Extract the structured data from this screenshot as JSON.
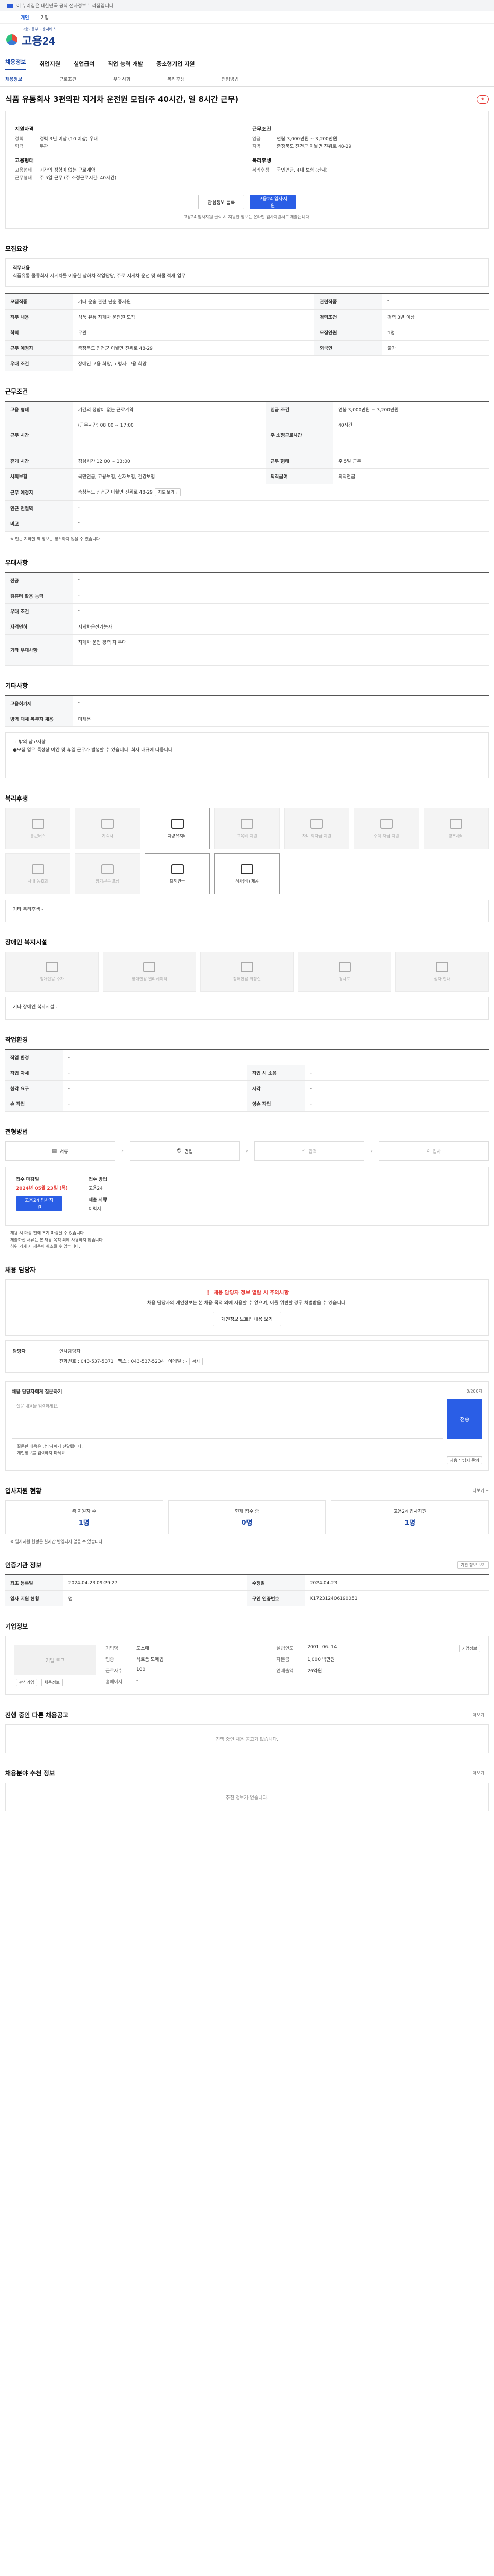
{
  "topbar": {
    "notice": "이 누리집은 대한민국 공식 전자정부 누리집입니다.",
    "toggle": "▼"
  },
  "mode": {
    "a": "개인",
    "b": "기업"
  },
  "logo": {
    "name": "고용24",
    "sub1": "고용노동부 고용서비스",
    "sub2": "통합 플랫폼"
  },
  "gnb": [
    "채용정보",
    "취업지원",
    "실업급여",
    "직업 능력 개발",
    "중소형기업 지원"
  ],
  "subnav": [
    "채용정보",
    "근로조건",
    "우대사항",
    "복리후생",
    "전형방법"
  ],
  "job": {
    "title": "식품 유통회사 3편의판 지게차 운전원 모집(주 40시간, 일 8시간 근무)",
    "scrap": "스크랩"
  },
  "summary": {
    "left": {
      "h1": "지원자격",
      "k1": "경력",
      "v1": "경력 3년 이상 (10 이상) 우대",
      "k2": "학력",
      "v2": "무관",
      "h2": "고용형태",
      "k3": "고용형태",
      "v3": "기간의 정함이 없는 근로계약",
      "k4": "근무형태",
      "v4": "주 5일 근무 (주 소정근로시간: 40시간)"
    },
    "right": {
      "h1": "근무조건",
      "k1": "임금",
      "v1": "연봉 3,000만원 ~ 3,200만원",
      "k2": "지역",
      "v2": "충청북도 진천군 이월면 진위로 48-29",
      "h2": "복리후생",
      "k3": "복리후생",
      "v3": "국민연금, 4대 보험 (산재)"
    }
  },
  "actions": {
    "interest": "관심정보 등록",
    "apply": "고용24 입사지원"
  },
  "actions_note": "고용24 입사지원 클릭 시 지원한 정보는 온라인 입사지원서로 제출됩니다.",
  "s1": {
    "title": "모집요강",
    "box_h": "직무내용",
    "box": "식품유통 물류회사 지게차를 이용한 상하차 작업담당, 주로 지게차 운전 및 화물 적재 업무",
    "rows": [
      [
        "모집직종",
        "기타 운송 관련 단순 종사원",
        "관련직종",
        "-"
      ],
      [
        "직무 내용",
        "식품 유통 지게차 운전원 모집",
        "경력조건",
        "경력 3년 이상"
      ],
      [
        "학력",
        "무관",
        "모집인원",
        "1명"
      ],
      [
        "근무 예정지",
        "충청북도 진천군 이월면 진위로 48-29",
        "외국인",
        "불가"
      ],
      [
        "우대 조건",
        "장애인 고용 희망, 고령자 고용 희망",
        "",
        ""
      ]
    ]
  },
  "s2": {
    "title": "근무조건",
    "rows": [
      [
        "고용 형태",
        "기간의 정함이 없는 근로계약",
        "임금 조건",
        "연봉 3,000만원 ~ 3,200만원"
      ],
      [
        "근무 시간",
        "(근무시간) 08:00 ~ 17:00",
        "주 소정근로시간",
        "40시간"
      ],
      [
        "휴게 시간",
        "점심시간 12:00 ~ 13:00",
        "근무 형태",
        "주 5일 근무"
      ],
      [
        "사회보험",
        "국민연금, 고용보험, 산재보험, 건강보험",
        "퇴직급여",
        "퇴직연금"
      ],
      [
        "근무 예정지",
        "충청북도 진천군 이월면 진위로 48-29",
        "",
        ""
      ],
      [
        "인근 전철역",
        "-",
        "",
        ""
      ],
      [
        "비고",
        "-",
        "",
        ""
      ]
    ],
    "note": "※ 인근 지하철 역 정보는 정확하지 않을 수 있습니다."
  },
  "s3": {
    "title": "우대사항",
    "rows": [
      [
        "전공",
        "-"
      ],
      [
        "컴퓨터 활용 능력",
        "-"
      ],
      [
        "우대 조건",
        "-"
      ],
      [
        "자격면허",
        "지게차운전기능사"
      ],
      [
        "기타 우대사항",
        "지게차 운전 경력 자 우대"
      ]
    ]
  },
  "s4": {
    "title": "기타사항",
    "rows": [
      [
        "고용허가제",
        "-"
      ],
      [
        "병역 대체 복무자 채용",
        "미채용"
      ]
    ],
    "etc": "그 밖의 참고사항\n●모집 업무 특성상 야간 및 휴일 근무가 발생할 수 있습니다. 회사 내규에 따릅니다."
  },
  "s5": {
    "title": "복리후생",
    "items": [
      "통근버스",
      "기숙사",
      "차량유지비",
      "교육비 지원",
      "자녀 학자금 지원",
      "주택 자금 지원",
      "경조사비",
      "사내 동호회",
      "장기근속 포상",
      "퇴직연금",
      "식사(비) 제공"
    ],
    "note": "기타 복리후생 -"
  },
  "s6": {
    "title": "장애인 복지시설",
    "items": [
      "장애인용 주차",
      "장애인용 엘리베이터",
      "장애인용 화장실",
      "경사로",
      "점자 안내"
    ],
    "note": "기타 장애인 복지시설 -"
  },
  "s7": {
    "title": "작업환경",
    "rows": [
      [
        "작업 환경",
        "-",
        "",
        ""
      ],
      [
        "작업 자세",
        "-",
        "작업 시 소음",
        "-"
      ],
      [
        "청각 요구",
        "-",
        "시각",
        "-"
      ],
      [
        "손 작업",
        "-",
        "양손 작업",
        "-"
      ]
    ]
  },
  "s8": {
    "title": "전형방법",
    "steps": [
      "서류",
      "면접",
      "합격",
      "입사"
    ],
    "apply": {
      "k1": "접수 마감일",
      "v1": "2024년 05월 23일 (목)",
      "k2": "접수 방법",
      "v2": "고용24",
      "k3": "제출 서류",
      "v3": "이력서",
      "btn": "고용24 입사지원"
    },
    "notes": [
      "채용 시 마감 전에 조기 마감될 수 있습니다.",
      "제출하신 서류는 본 채용 목적 외에 사용하지 않습니다.",
      "허위 기재 시 채용이 취소될 수 있습니다."
    ]
  },
  "s9": {
    "title": "채용 담당자",
    "warn_h": "❗ 채용 담당자 정보 열람 시 주의사항",
    "warn": "채용 담당자의 개인정보는 본 채용 목적 외에 사용할 수 없으며, 이를 위반할 경우 처벌받을 수 있습니다.",
    "btn": "개인정보 보호법 내용 보기",
    "contact": {
      "k": "담당자",
      "name": "인사담당자",
      "phone": "전화번호 : 043-537-5371",
      "fax": "팩스 : 043-537-5234",
      "email": "이메일 : -",
      "copy": "복사"
    }
  },
  "s10": {
    "title": "채용 담당자에게 질문하기",
    "count": "0/200자",
    "placeholder": "질문 내용을 입력하세요.",
    "send": "전송",
    "notes": [
      "질문한 내용은 담당자에게 전달됩니다.",
      "개인정보를 입력하지 마세요."
    ],
    "btn": "채용 담당자 문의"
  },
  "s11": {
    "title": "입사지원 현황",
    "more": "더보기 +",
    "stats": [
      [
        "총 지원자 수",
        "1명"
      ],
      [
        "현재 접수 중",
        "0명"
      ],
      [
        "고용24 입사지원",
        "1명"
      ]
    ],
    "note": "※ 입사지원 현황은 실시간 반영되지 않을 수 있습니다."
  },
  "s12": {
    "title": "인증기관 정보",
    "btn": "기관 정보 보기",
    "rows": [
      [
        "최초 등록일",
        "2024-04-23 09:29:27",
        "수정일",
        "2024-04-23"
      ],
      [
        "입사 지원 현황",
        "명",
        "구인 인증번호",
        "K172312406190051"
      ]
    ]
  },
  "s13": {
    "title": "기업정보",
    "logo": "기업 로고",
    "rows": [
      [
        "기업명",
        "도소매",
        "설립연도",
        "2001. 06. 14"
      ],
      [
        "업종",
        "식료품 도매업",
        "자본금",
        "1,000 백만원"
      ],
      [
        "근로자수",
        "100",
        "연매출액",
        "26억원"
      ],
      [
        "홈페이지",
        "-",
        "",
        ""
      ]
    ],
    "b1": "관심기업",
    "b2": "채용정보",
    "b3": "기업정보"
  },
  "s14": {
    "title": "진행 중인 다른 채용공고",
    "more": "더보기 +",
    "empty": "진행 중인 채용 공고가 없습니다."
  },
  "s15": {
    "title": "채용분야 추천 정보",
    "more": "더보기 +",
    "empty": "추천 정보가 없습니다."
  }
}
